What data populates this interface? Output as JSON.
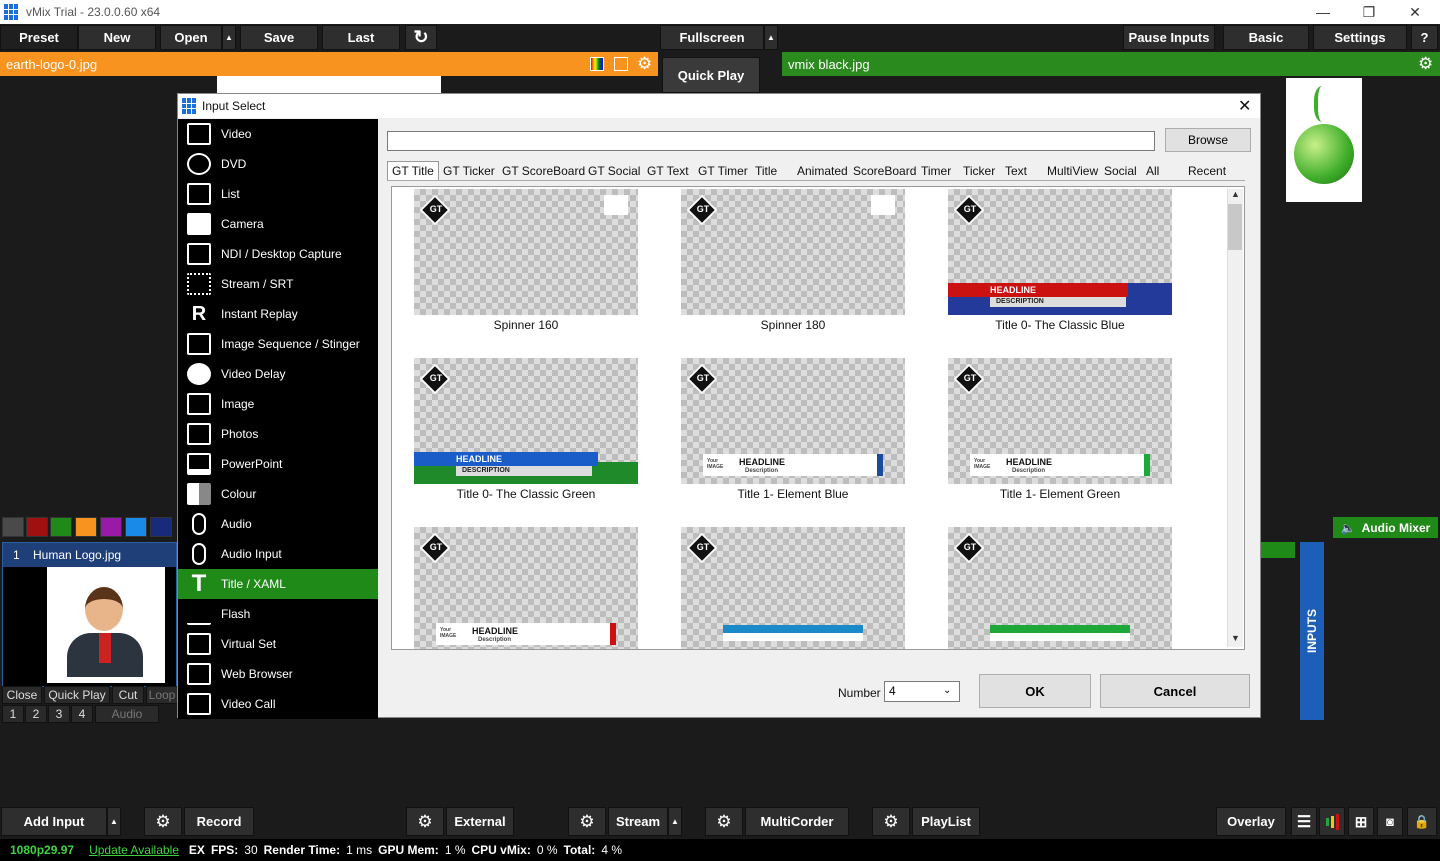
{
  "window": {
    "title": "vMix Trial - 23.0.0.60 x64"
  },
  "toolbar": {
    "preset": "Preset",
    "new": "New",
    "open": "Open",
    "save": "Save",
    "last": "Last",
    "fullscreen": "Fullscreen",
    "quick_play": "Quick Play",
    "pause_inputs": "Pause Inputs",
    "basic": "Basic",
    "settings": "Settings",
    "help": "?"
  },
  "preview": {
    "title": "earth-logo-0.jpg"
  },
  "program": {
    "title": "vmix black.jpg"
  },
  "dialog": {
    "title": "Input Select",
    "browse": "Browse",
    "categories": [
      "Video",
      "DVD",
      "List",
      "Camera",
      "NDI / Desktop Capture",
      "Stream / SRT",
      "Instant Replay",
      "Image Sequence / Stinger",
      "Video Delay",
      "Image",
      "Photos",
      "PowerPoint",
      "Colour",
      "Audio",
      "Audio Input",
      "Title / XAML",
      "Flash",
      "Virtual Set",
      "Web Browser",
      "Video Call"
    ],
    "selected_category": "Title / XAML",
    "tabs": [
      "GT Title",
      "GT Ticker",
      "GT ScoreBoard",
      "GT Social",
      "GT Text",
      "GT Timer",
      "Title",
      "Animated",
      "ScoreBoard",
      "Timer",
      "Ticker",
      "Text",
      "MultiView",
      "Social",
      "All",
      "Recent"
    ],
    "selected_tab": "GT Title",
    "templates": [
      {
        "name": "Spinner 160"
      },
      {
        "name": "Spinner 180"
      },
      {
        "name": "Title 0- The Classic Blue"
      },
      {
        "name": "Title 0- The Classic Green"
      },
      {
        "name": "Title 1- Element Blue"
      },
      {
        "name": "Title 1- Element Green"
      },
      {
        "name": ""
      },
      {
        "name": ""
      },
      {
        "name": ""
      }
    ],
    "gt_badge": "GT",
    "headline": "HEADLINE",
    "description": "DESCRIPTION",
    "description_small": "Description",
    "your_image": "Your IMAGE",
    "number_label": "Number",
    "number_value": "4",
    "ok": "OK",
    "cancel": "Cancel"
  },
  "input_card": {
    "number": "1",
    "name": "Human Logo.jpg",
    "close": "Close",
    "quick_play": "Quick Play",
    "cut": "Cut",
    "loop": "Loop",
    "slots": [
      "1",
      "2",
      "3",
      "4"
    ],
    "audio": "Audio"
  },
  "audio_mixer": {
    "label": "Audio Mixer"
  },
  "inputs_label": "INPUTS",
  "bottom": {
    "add_input": "Add Input",
    "record": "Record",
    "external": "External",
    "stream": "Stream",
    "multicorder": "MultiCorder",
    "playlist": "PlayList",
    "overlay": "Overlay"
  },
  "status": {
    "format": "1080p29.97",
    "update": "Update Available",
    "ex": "EX",
    "fps_label": "FPS:",
    "fps": "30",
    "render_label": "Render Time:",
    "render": "1 ms",
    "gpu_label": "GPU Mem:",
    "gpu": "1 %",
    "cpu_label": "CPU vMix:",
    "cpu": "0 %",
    "total_label": "Total:",
    "total": "4 %"
  },
  "colors": {
    "preview_bar": "#f7931e",
    "program_bar": "#2a8a1d",
    "selected": "#1f8a18",
    "swatches": [
      "#4a4a4a",
      "#a01010",
      "#1f8a18",
      "#f7931e",
      "#9a1aa8",
      "#1a8ae8",
      "#1a2a7a"
    ]
  }
}
